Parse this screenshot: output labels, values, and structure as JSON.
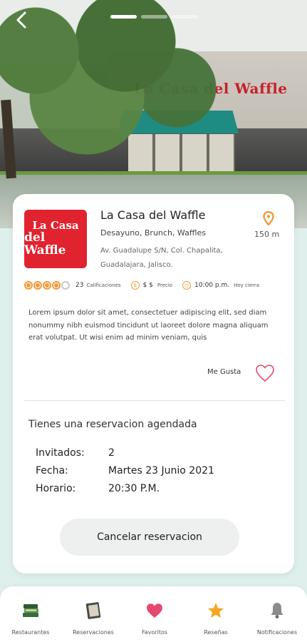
{
  "hero": {
    "sign_text": "La Casa del Waffle",
    "page_count": 3,
    "active_page": 1
  },
  "restaurant": {
    "logo_line1": "La Casa",
    "logo_line2": "del Waffle",
    "name": "La Casa del Waffle",
    "categories": "Desayuno, Brunch, Waffles",
    "address": "Av. Guadalupe S/N, Col. Chapalita, Guadalajara, Jalisco.",
    "distance": "150 m",
    "rating": 4,
    "rating_max": 5,
    "rating_count": "23",
    "rating_label": "Calificaciones",
    "price": "$ $",
    "price_label": "Precio",
    "hours": "10:00 p.m.",
    "hours_label": "Hoy cierra",
    "description": "Lorem ipsum dolor sit amet, consectetuer adipiscing elit, sed diam nonummy nibh euismod tincidunt ut laoreet dolore magna aliquam erat volutpat. Ut wisi enim ad minim veniam, quis",
    "like_label": "Me Gusta"
  },
  "reservation": {
    "title": "Tienes una reservacion agendada",
    "guests_label": "Invitados:",
    "guests_value": "2",
    "date_label": "Fecha:",
    "date_value": "Martes 23 Junio 2021",
    "time_label": "Horario:",
    "time_value": "20:30 P.M.",
    "cancel_label": "Cancelar reservacion"
  },
  "bottom_nav": {
    "items": [
      {
        "label": "Restaurantes",
        "icon": "books-icon"
      },
      {
        "label": "Reservaciones",
        "icon": "notebook-icon"
      },
      {
        "label": "Favoritos",
        "icon": "heart-icon"
      },
      {
        "label": "Reseñas",
        "icon": "star-icon"
      },
      {
        "label": "Notificaciones",
        "icon": "bell-icon"
      }
    ]
  },
  "colors": {
    "accent": "#f29a3a",
    "brand_red": "#e0232f",
    "heart_pink": "#e8476e",
    "background": "#dff0ec"
  }
}
